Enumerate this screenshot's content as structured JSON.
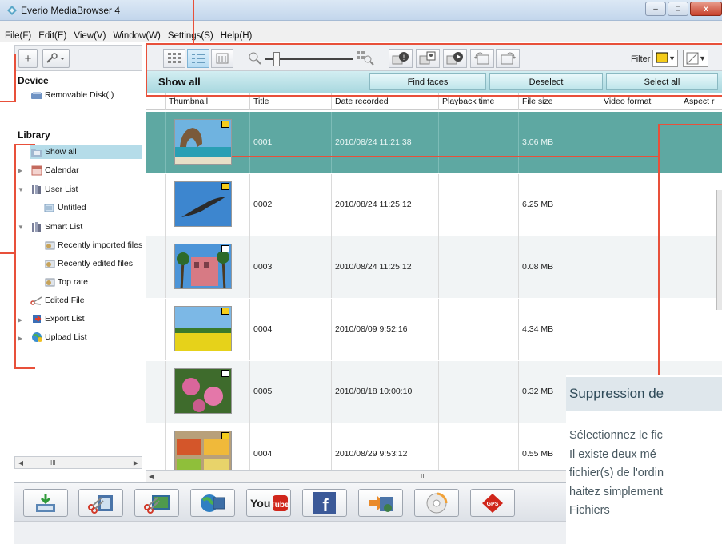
{
  "window": {
    "title": "Everio MediaBrowser 4",
    "min_glyph": "–",
    "max_glyph": "□",
    "close_glyph": "x"
  },
  "menu": [
    "File(F)",
    "Edit(E)",
    "View(V)",
    "Window(W)",
    "Settings(S)",
    "Help(H)"
  ],
  "toolbar": {
    "filter_label": "Filter",
    "left_add": "+"
  },
  "sidebar": {
    "device_heading": "Device",
    "device_items": [
      "Removable Disk(I)"
    ],
    "library_heading": "Library",
    "library_items": [
      {
        "label": "Show all",
        "selected": true,
        "icon": "folder-icon"
      },
      {
        "label": "Calendar",
        "icon": "calendar-icon"
      },
      {
        "label": "User List",
        "icon": "books-icon"
      },
      {
        "label": "Untitled",
        "icon": "list-icon"
      },
      {
        "label": "Smart List",
        "icon": "books-icon"
      },
      {
        "label": "Recently imported files",
        "icon": "smartlist-icon"
      },
      {
        "label": "Recently edited files",
        "icon": "smartlist-icon"
      },
      {
        "label": "Top rate",
        "icon": "smartlist-icon"
      },
      {
        "label": "Edited File",
        "icon": "scissors-icon"
      },
      {
        "label": "Export List",
        "icon": "export-icon"
      },
      {
        "label": "Upload List",
        "icon": "globe-icon"
      }
    ],
    "scroll_text": "III"
  },
  "main": {
    "header_label": "Show all",
    "find_faces": "Find faces",
    "deselect": "Deselect",
    "select_all": "Select all",
    "columns": [
      "Thumbnail",
      "Title",
      "Date recorded",
      "Playback time",
      "File size",
      "Video format",
      "Aspect r"
    ],
    "scroll_text": "III"
  },
  "rows": [
    {
      "title": "0001",
      "date": "2010/08/24 11:21:38",
      "size": "3.06 MB",
      "badge": "video",
      "thumb": "beach"
    },
    {
      "title": "0002",
      "date": "2010/08/24 11:25:12",
      "size": "6.25 MB",
      "badge": "video",
      "thumb": "bird"
    },
    {
      "title": "0003",
      "date": "2010/08/24 11:25:12",
      "size": "0.08 MB",
      "badge": "photo",
      "thumb": "palms"
    },
    {
      "title": "0004",
      "date": "2010/08/09 9:52:16",
      "size": "4.34 MB",
      "badge": "video",
      "thumb": "field"
    },
    {
      "title": "0005",
      "date": "2010/08/18 10:00:10",
      "size": "0.32 MB",
      "badge": "photo",
      "thumb": "flowers"
    },
    {
      "title": "0004",
      "date": "2010/08/29 9:53:12",
      "size": "0.55 MB",
      "badge": "video",
      "thumb": "market"
    }
  ],
  "bottom_buttons": [
    "import-icon",
    "edit-video-icon",
    "edit-photo-icon",
    "globe-export-icon",
    "youtube-icon",
    "facebook-icon",
    "export-device-icon",
    "disc-icon",
    "gps-icon"
  ],
  "bottom_labels": {
    "youtube": "YouTube",
    "facebook": "f",
    "gps": "GPS"
  },
  "overlay_panel": {
    "heading": "Suppression de",
    "lines": [
      "Sélectionnez le fic",
      "Il existe deux mé",
      "fichier(s) de l'ordin",
      "haitez simplement",
      "Fichiers"
    ]
  },
  "colors": {
    "accent": "#e8503a",
    "selected_row": "#5ea8a2",
    "header": "#a9d8df"
  }
}
